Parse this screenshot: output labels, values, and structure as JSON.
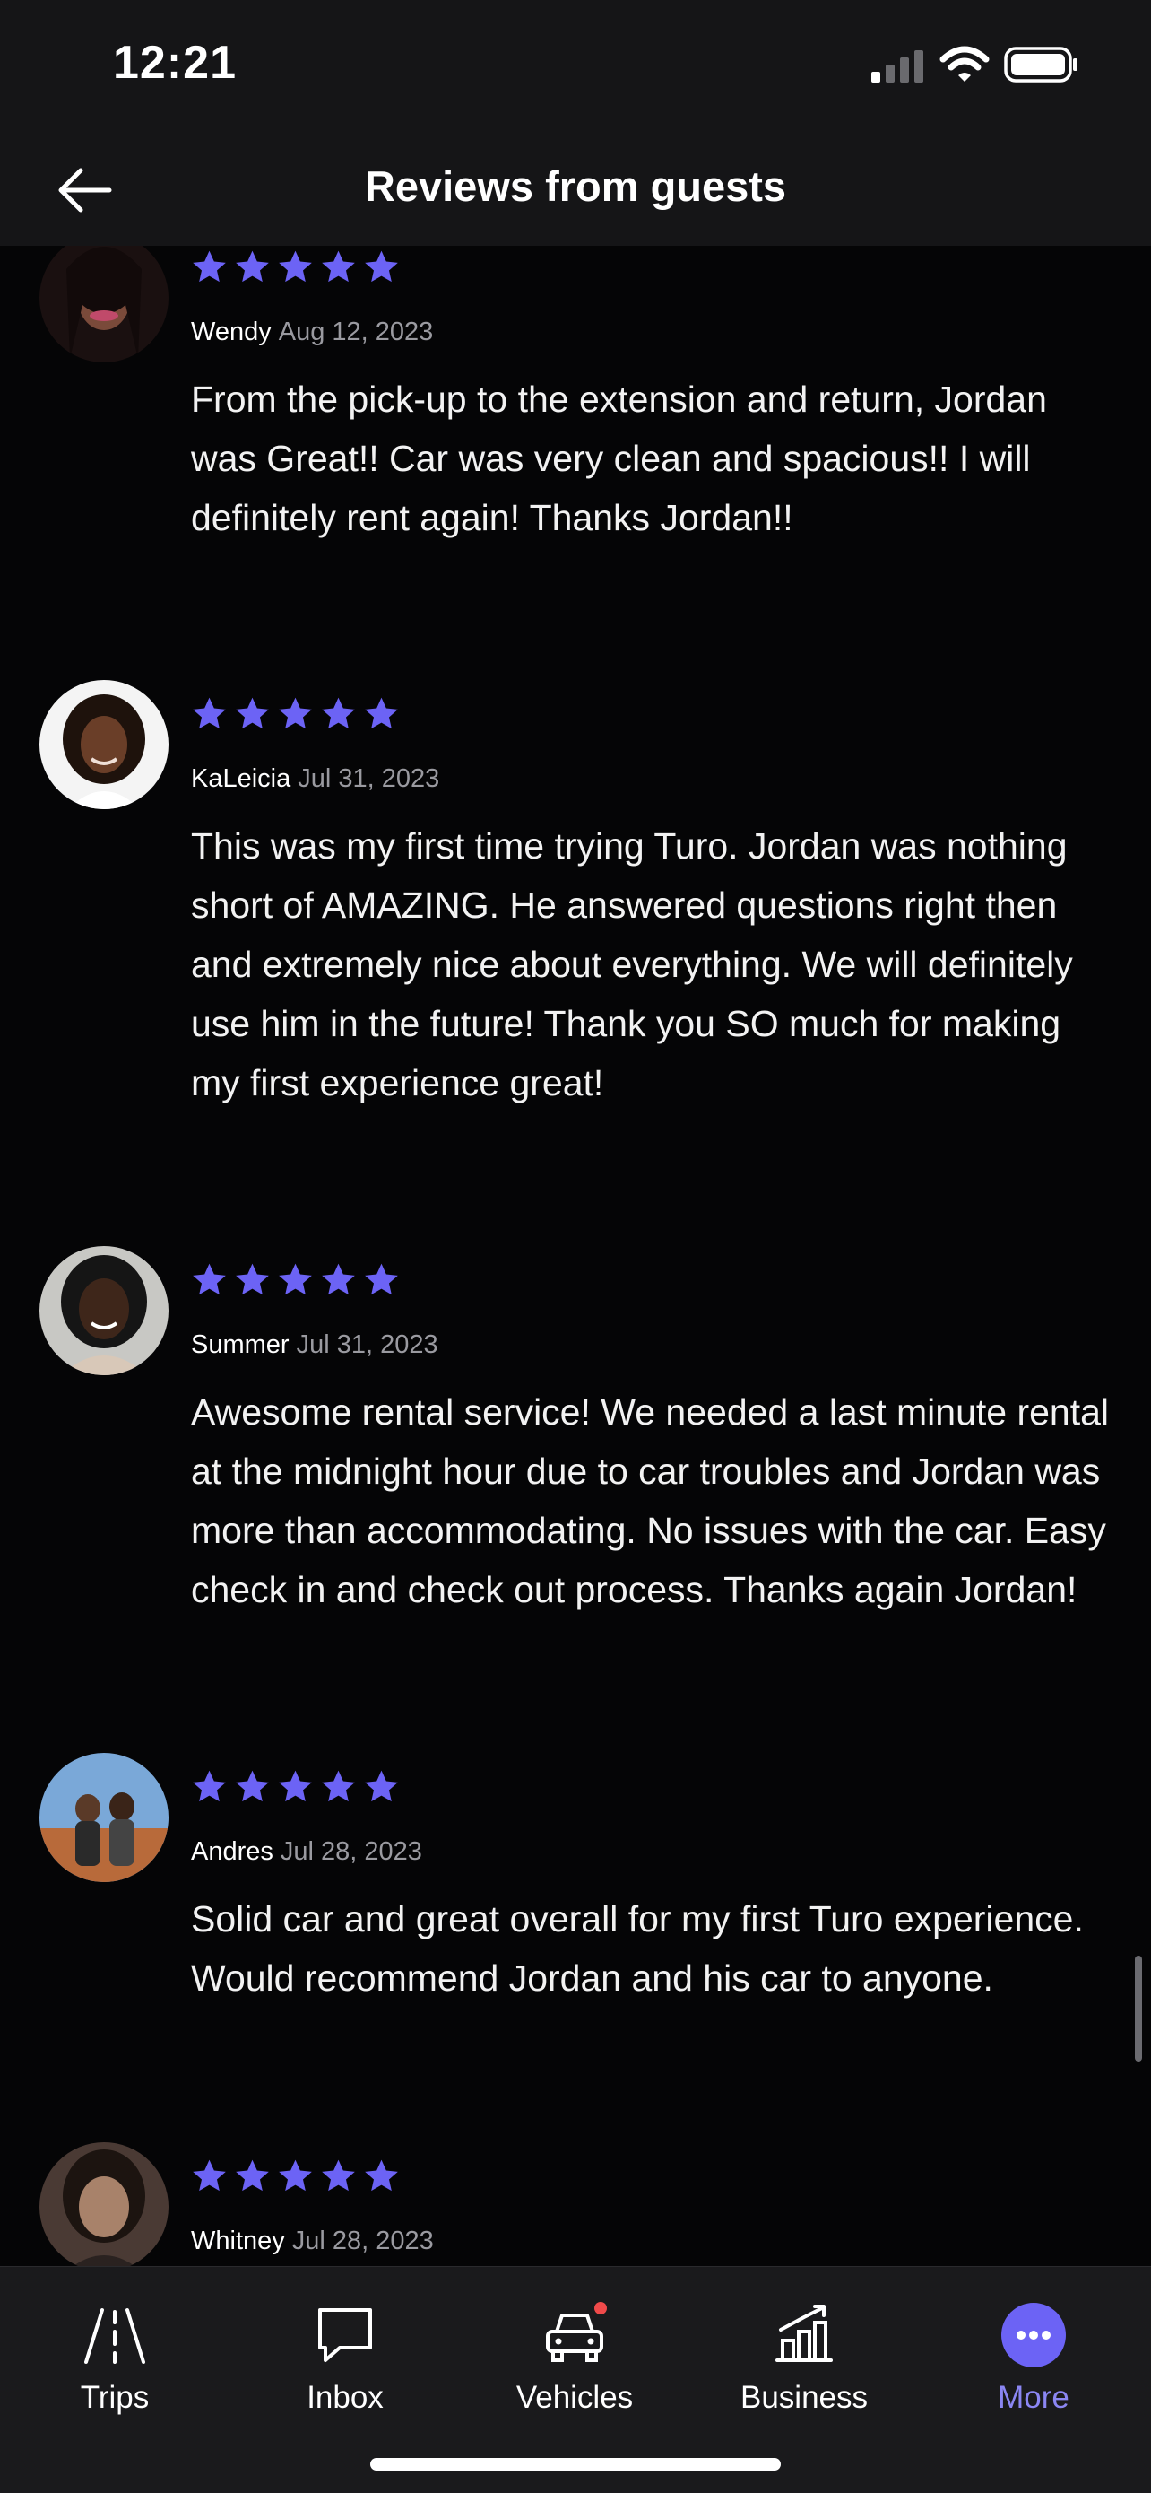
{
  "status_bar": {
    "time": "12:21"
  },
  "header": {
    "title": "Reviews from guests"
  },
  "colors": {
    "star": "#6c63f5",
    "active_tab": "#8b86f2",
    "badge": "#f04a4a"
  },
  "reviews": [
    {
      "name": "Wendy",
      "date": "Aug 12, 2023",
      "rating": 5,
      "text": "From the pick-up to the extension and return, Jordan was Great!! Car was very clean and spacious!! I will definitely rent again! Thanks Jordan!!"
    },
    {
      "name": "KaLeicia",
      "date": "Jul 31, 2023",
      "rating": 5,
      "text": "This was my first time trying Turo. Jordan was nothing short of AMAZING. He answered questions right then and extremely nice about everything. We will definitely use him in the future! Thank you SO much for making my first experience great!"
    },
    {
      "name": "Summer",
      "date": "Jul 31, 2023",
      "rating": 5,
      "text": "Awesome rental service! We needed a last minute rental at the midnight hour due to car troubles and Jordan was more than accommodating. No issues with the car. Easy check in and check out process. Thanks again Jordan!"
    },
    {
      "name": "Andres",
      "date": "Jul 28, 2023",
      "rating": 5,
      "text": "Solid car and great overall for my first Turo experience. Would recommend Jordan and his car to anyone."
    },
    {
      "name": "Whitney",
      "date": "Jul 28, 2023",
      "rating": 5,
      "text": ""
    }
  ],
  "tabs": [
    {
      "label": "Trips",
      "icon": "road-icon",
      "active": false
    },
    {
      "label": "Inbox",
      "icon": "chat-bubble-icon",
      "active": false
    },
    {
      "label": "Vehicles",
      "icon": "car-icon",
      "active": false,
      "badge": true
    },
    {
      "label": "Business",
      "icon": "bar-chart-icon",
      "active": false
    },
    {
      "label": "More",
      "icon": "more-dots-icon",
      "active": true
    }
  ]
}
